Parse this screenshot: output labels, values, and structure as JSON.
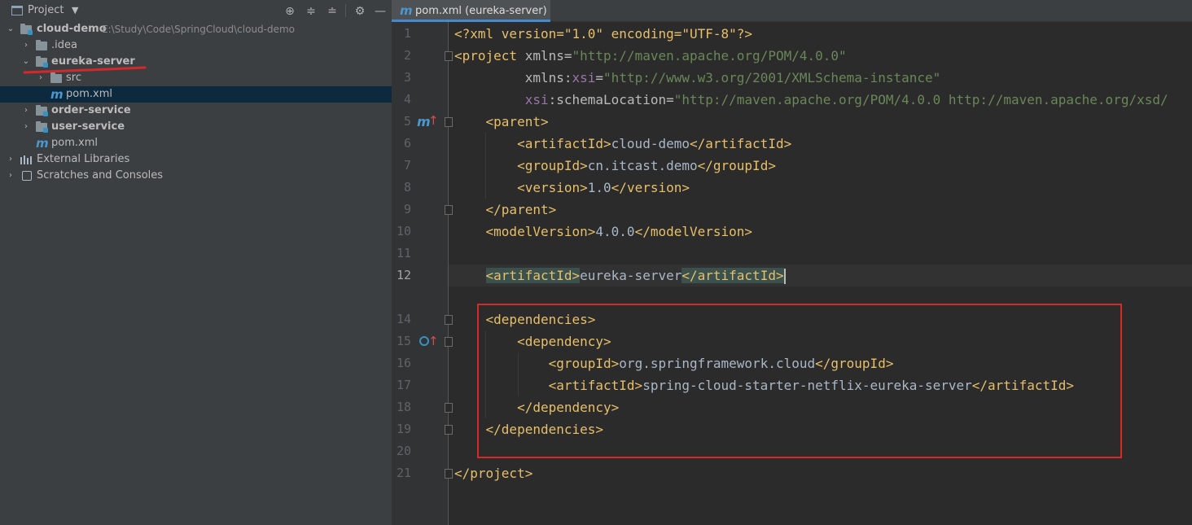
{
  "project_panel": {
    "title": "Project",
    "tree": [
      {
        "label": "cloud-demo",
        "path": "E:\\Study\\Code\\SpringCloud\\cloud-demo"
      },
      {
        "label": ".idea"
      },
      {
        "label": "eureka-server"
      },
      {
        "label": "src"
      },
      {
        "label": "pom.xml"
      },
      {
        "label": "order-service"
      },
      {
        "label": "user-service"
      },
      {
        "label": "pom.xml"
      },
      {
        "label": "External Libraries"
      },
      {
        "label": "Scratches and Consoles"
      }
    ]
  },
  "editor": {
    "tab_label": "pom.xml (eureka-server)",
    "line_numbers": [
      "1",
      "2",
      "3",
      "4",
      "5",
      "6",
      "7",
      "8",
      "9",
      "10",
      "11",
      "12",
      "14",
      "15",
      "16",
      "17",
      "18",
      "19",
      "20",
      "21"
    ],
    "current_line": "12",
    "lines": {
      "l1": [
        "<?xml version=\"1.0\" encoding=\"UTF-8\"?>"
      ],
      "l2": [
        "<project",
        " xmlns",
        "=",
        "\"http://maven.apache.org/POM/4.0.0\""
      ],
      "l3": [
        "xmlns:",
        "xsi",
        "=",
        "\"http://www.w3.org/2001/XMLSchema-instance\""
      ],
      "l4": [
        "xsi",
        ":schemaLocation",
        "=",
        "\"http://maven.apache.org/POM/4.0.0 http://maven.apache.org/xsd/"
      ],
      "l5": "<parent>",
      "l6": [
        "<artifactId>",
        "cloud-demo",
        "</artifactId>"
      ],
      "l7": [
        "<groupId>",
        "cn.itcast.demo",
        "</groupId>"
      ],
      "l8": [
        "<version>",
        "1.0",
        "</version>"
      ],
      "l9": "</parent>",
      "l10": [
        "<modelVersion>",
        "4.0.0",
        "</modelVersion>"
      ],
      "l12": [
        "<artifactId>",
        "eureka-server",
        "</artifactId>"
      ],
      "l14": "<dependencies>",
      "l15": "<dependency>",
      "l16": [
        "<groupId>",
        "org.springframework.cloud",
        "</groupId>"
      ],
      "l17": [
        "<artifactId>",
        "spring-cloud-starter-netflix-eureka-server",
        "</artifactId>"
      ],
      "l18": "</dependency>",
      "l19": "</dependencies>",
      "l21": "</project>"
    }
  },
  "colors": {
    "tag": "#e8bf6a",
    "string": "#6a8759",
    "namespace": "#9876aa",
    "text": "#a9b7c6",
    "annotation_red": "#d5282a",
    "selection": "#0d293e"
  }
}
